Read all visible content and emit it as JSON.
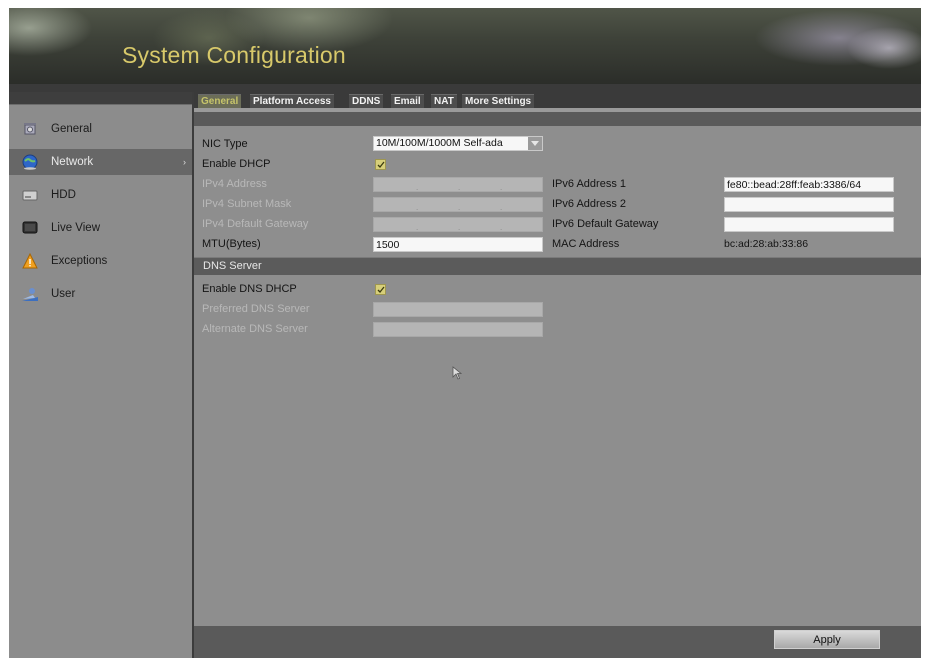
{
  "header": {
    "title": "System Configuration"
  },
  "sidebar": {
    "items": [
      {
        "label": "General",
        "icon": "gear-icon",
        "active": false
      },
      {
        "label": "Network",
        "icon": "globe-icon",
        "active": true
      },
      {
        "label": "HDD",
        "icon": "hdd-icon",
        "active": false
      },
      {
        "label": "Live View",
        "icon": "monitor-icon",
        "active": false
      },
      {
        "label": "Exceptions",
        "icon": "warning-icon",
        "active": false
      },
      {
        "label": "User",
        "icon": "user-icon",
        "active": false
      }
    ]
  },
  "tabs": [
    {
      "label": "General",
      "active": true
    },
    {
      "label": "Platform Access",
      "active": false
    },
    {
      "label": "DDNS",
      "active": false
    },
    {
      "label": "Email",
      "active": false
    },
    {
      "label": "NAT",
      "active": false
    },
    {
      "label": "More Settings",
      "active": false
    }
  ],
  "form": {
    "nic_type": {
      "label": "NIC Type",
      "value": "10M/100M/1000M Self-ada"
    },
    "enable_dhcp": {
      "label": "Enable DHCP",
      "checked": true
    },
    "ipv4_address": {
      "label": "IPv4 Address",
      "value": "",
      "disabled": true
    },
    "ipv4_subnet": {
      "label": "IPv4 Subnet Mask",
      "value": "",
      "disabled": true
    },
    "ipv4_gateway": {
      "label": "IPv4 Default Gateway",
      "value": "",
      "disabled": true
    },
    "mtu": {
      "label": "MTU(Bytes)",
      "value": "1500"
    },
    "ipv6_address_1": {
      "label": "IPv6 Address 1",
      "value": "fe80::bead:28ff:feab:3386/64"
    },
    "ipv6_address_2": {
      "label": "IPv6 Address 2",
      "value": ""
    },
    "ipv6_gateway": {
      "label": "IPv6 Default Gateway",
      "value": ""
    },
    "mac_address": {
      "label": "MAC Address",
      "value": "bc:ad:28:ab:33:86"
    }
  },
  "dns": {
    "section_title": "DNS Server",
    "enable_dns_dhcp": {
      "label": "Enable DNS DHCP",
      "checked": true
    },
    "preferred": {
      "label": "Preferred DNS Server",
      "value": "",
      "disabled": true
    },
    "alternate": {
      "label": "Alternate DNS Server",
      "value": "",
      "disabled": true
    }
  },
  "footer": {
    "apply_label": "Apply"
  },
  "colors": {
    "accent_title": "#d8c96a",
    "active_tab_text": "#c6c46a",
    "panel_gray": "#8e8e8e"
  }
}
